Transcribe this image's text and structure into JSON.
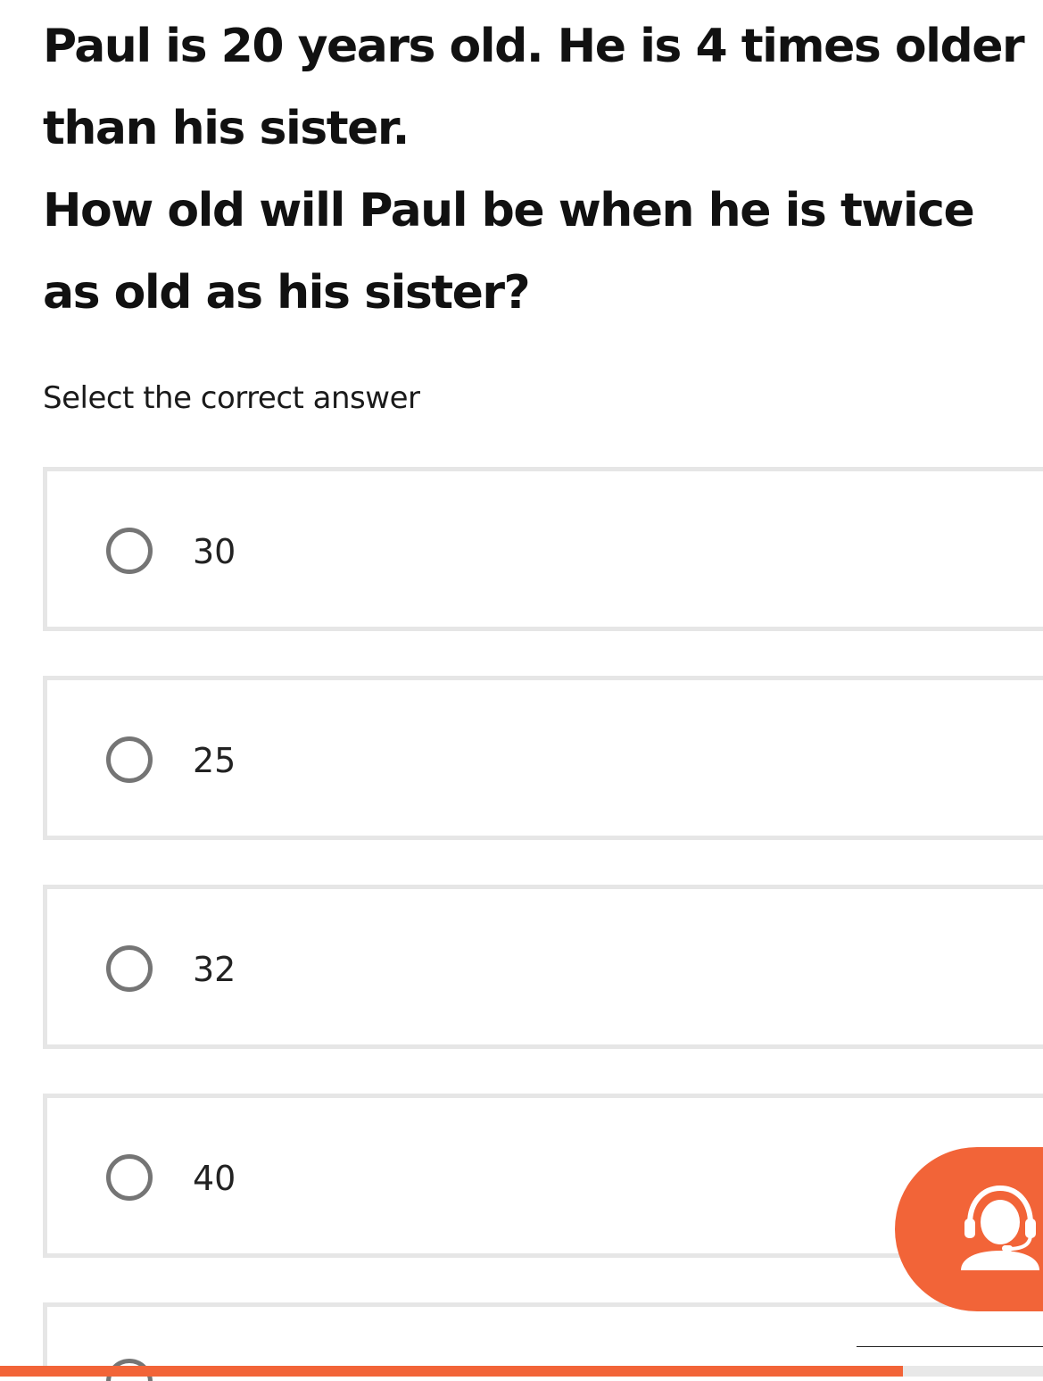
{
  "question": {
    "line1": "Paul is 20 years old. He is 4 times older than his sister.",
    "line2": "How old will Paul be when he is twice as old as his sister?"
  },
  "instruction": "Select the correct answer",
  "options": [
    {
      "label": "30",
      "selected": false
    },
    {
      "label": "25",
      "selected": false
    },
    {
      "label": "32",
      "selected": false
    },
    {
      "label": "40",
      "selected": false
    }
  ],
  "support_button": {
    "icon": "headset-support-icon"
  },
  "progress": {
    "fraction": 0.866
  },
  "colors": {
    "accent": "#f26438",
    "option_border": "#e6e6e6",
    "radio_border": "#757575",
    "text": "#111111"
  }
}
